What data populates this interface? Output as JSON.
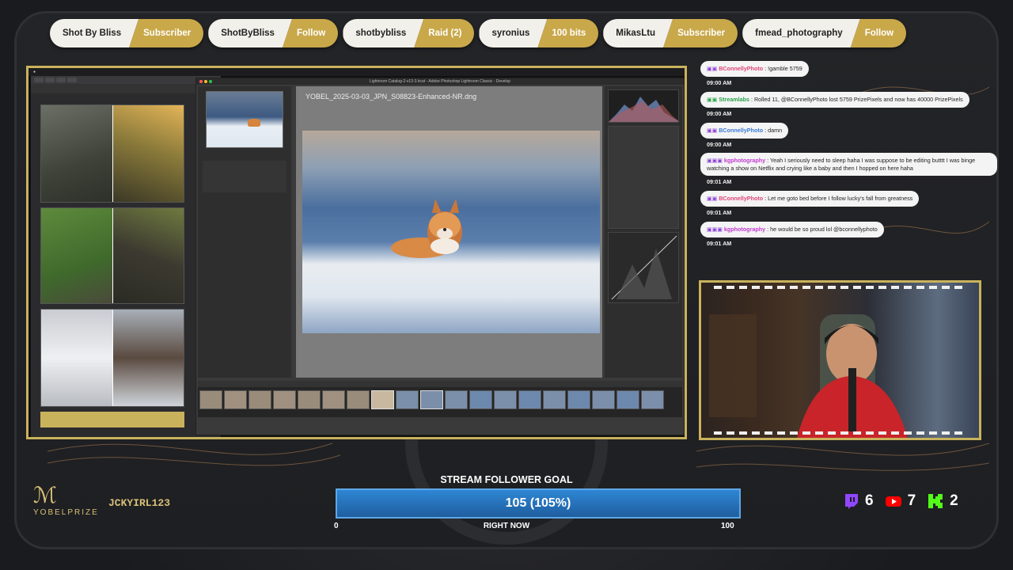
{
  "alerts": [
    {
      "name": "Shot By Bliss",
      "type": "Subscriber"
    },
    {
      "name": "ShotByBliss",
      "type": "Follow"
    },
    {
      "name": "shotbybliss",
      "type": "Raid (2)"
    },
    {
      "name": "syronius",
      "type": "100 bits"
    },
    {
      "name": "MikasLtu",
      "type": "Subscriber"
    },
    {
      "name": "fmead_photography",
      "type": "Follow"
    }
  ],
  "lightroom": {
    "window_title": "Lightroom Catalog-2-v13-3.lrcat - Adobe Photoshop Lightroom Classic - Develop",
    "filename": "YOBEL_2025-03-03_JPN_S08823-Enhanced-NR.dng"
  },
  "chat": [
    {
      "user": "BConnellyPhoto",
      "user_color": "#e0457b",
      "text": " : !gamble 5759",
      "time": "09:00 AM"
    },
    {
      "user": "Streamlabs",
      "user_color": "#2aa34a",
      "text": " : Rolled 11, @BConnellyPhoto lost 5759 PrizePixels and now has 40000 PrizePixels",
      "time": "09:00 AM"
    },
    {
      "user": "BConnellyPhoto",
      "user_color": "#3a7ad8",
      "text": " : damn",
      "time": "09:00 AM"
    },
    {
      "user": "kgphotography",
      "user_color": "#c23ad0",
      "text": " : Yeah I seriously need to sleep haha I was suppose to be editing butttt I was binge watching a show on Netflix and crying like a baby and then I hopped on here haha",
      "time": "09:01 AM"
    },
    {
      "user": "BConnellyPhoto",
      "user_color": "#e0457b",
      "text": " : Let me goto bed before I follow lucky's fall from greatness",
      "time": "09:01 AM"
    },
    {
      "user": "kgphotography",
      "user_color": "#c23ad0",
      "text": " : he would be so proud lol @bconnellyphoto",
      "time": "09:01 AM"
    }
  ],
  "brand": {
    "word": "YOBELPRIZE",
    "handle": "JCKYIRL123"
  },
  "goal": {
    "title": "STREAM FOLLOWER GOAL",
    "value_text": "105 (105%)",
    "min": "0",
    "label": "RIGHT NOW",
    "max": "100",
    "progress": 1.05
  },
  "socials": [
    {
      "icon": "twitch-icon",
      "count": "6",
      "color": "#9146ff"
    },
    {
      "icon": "youtube-icon",
      "count": "7",
      "color": "#ff0000"
    },
    {
      "icon": "kick-icon",
      "count": "2",
      "color": "#53fc18"
    }
  ]
}
